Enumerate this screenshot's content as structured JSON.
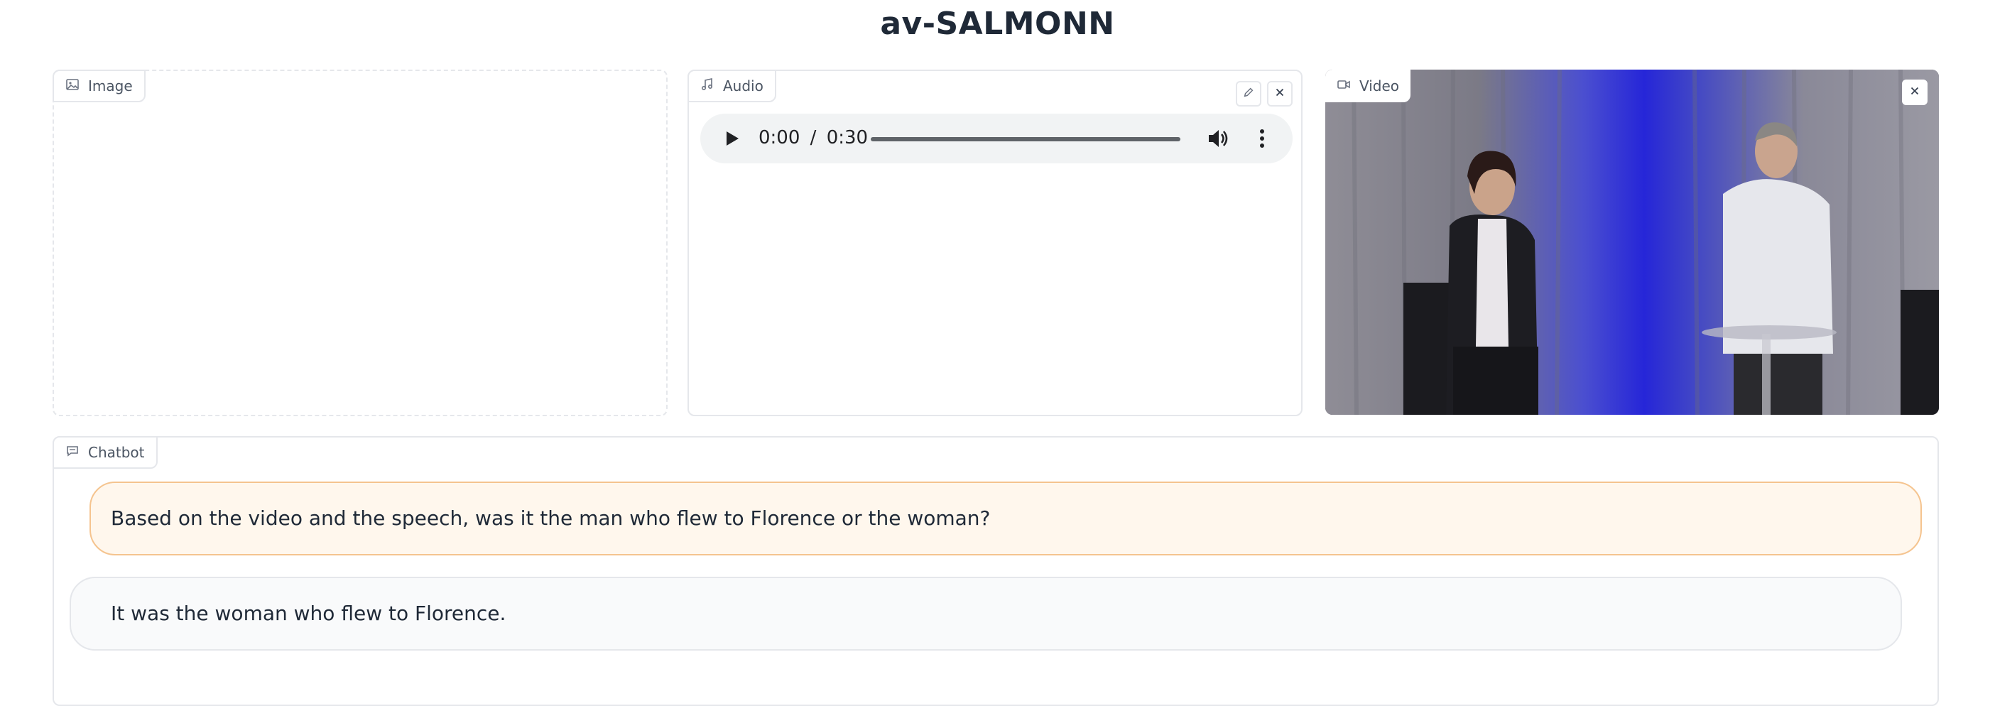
{
  "app": {
    "title": "av-SALMONN"
  },
  "panels": {
    "image": {
      "label": "Image",
      "icon": "image-icon"
    },
    "audio": {
      "label": "Audio",
      "icon": "music-icon",
      "player": {
        "time_current": "0:00",
        "time_separator": "/",
        "time_total": "0:30"
      }
    },
    "video": {
      "label": "Video",
      "icon": "video-camera-icon"
    },
    "chatbot": {
      "label": "Chatbot",
      "icon": "chat-icon"
    }
  },
  "chat": {
    "messages": [
      {
        "role": "user",
        "text": "Based on the video and the speech, was it the man who flew to Florence or the woman?"
      },
      {
        "role": "bot",
        "text": "It was the woman who flew to Florence."
      }
    ]
  },
  "colors": {
    "user_bubble_bg": "#fff7ed",
    "user_bubble_border": "#f5c48f",
    "bot_bubble_bg": "#f9fafb",
    "border": "#e5e7eb"
  }
}
